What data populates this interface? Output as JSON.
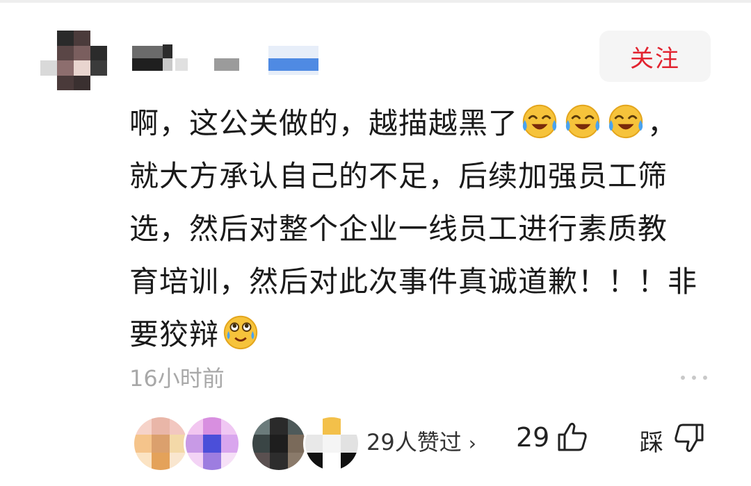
{
  "comment": {
    "follow_label": "关注",
    "lines": [
      "啊，这公关做的，越描越黑了",
      "，",
      "就大方承认自己的不足，后续加强员工筛",
      "选，然后对整个企业一线员工进行素质教",
      "育培训，然后对此次事件真诚道歉！！！非",
      "要狡辩"
    ],
    "time": "16小时前",
    "liked_text": "29人赞过",
    "like_count": "29",
    "dislike_label": "踩"
  },
  "icons": {
    "emoji_laugh_cry": "tears-of-joy-emoji-icon",
    "more": "more-dots-icon",
    "thumbs_up": "thumbs-up-icon",
    "thumbs_down": "thumbs-down-icon",
    "chevron": "chevron-right-icon"
  },
  "colors": {
    "follow_text": "#e2232f",
    "follow_bg": "#f5f5f5",
    "text_main": "#1a1a1a",
    "text_muted": "#a8a8a8"
  }
}
